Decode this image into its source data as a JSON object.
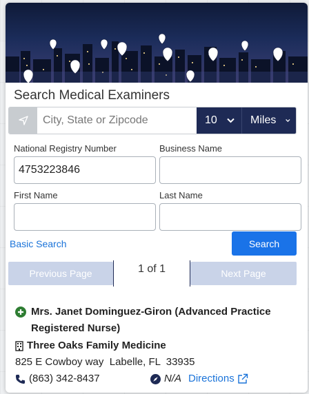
{
  "title": "Search Medical Examiners",
  "search": {
    "city_placeholder": "City, State or Zipcode",
    "distance": "10",
    "unit": "Miles"
  },
  "form": {
    "registry_label": "National Registry Number",
    "registry_value": "4753223846",
    "business_label": "Business Name",
    "business_value": "",
    "first_label": "First Name",
    "first_value": "",
    "last_label": "Last Name",
    "last_value": ""
  },
  "actions": {
    "basic_search": "Basic Search",
    "search": "Search"
  },
  "pager": {
    "prev": "Previous Page",
    "status": "1 of 1",
    "next": "Next Page"
  },
  "result": {
    "name": "Mrs. Janet Dominguez-Giron (Advanced Practice Registered Nurse)",
    "business": "Three Oaks Family Medicine",
    "address": "825 E Cowboy way  Labelle, FL  33935",
    "phone": "(863) 342-8437",
    "distance": "N/A",
    "directions": "Directions"
  },
  "colors": {
    "navy": "#1e2a55",
    "primary": "#1a73e8",
    "link": "#1a73d9",
    "disabled": "#c9d3e8",
    "badge_green": "#2e7d32"
  }
}
